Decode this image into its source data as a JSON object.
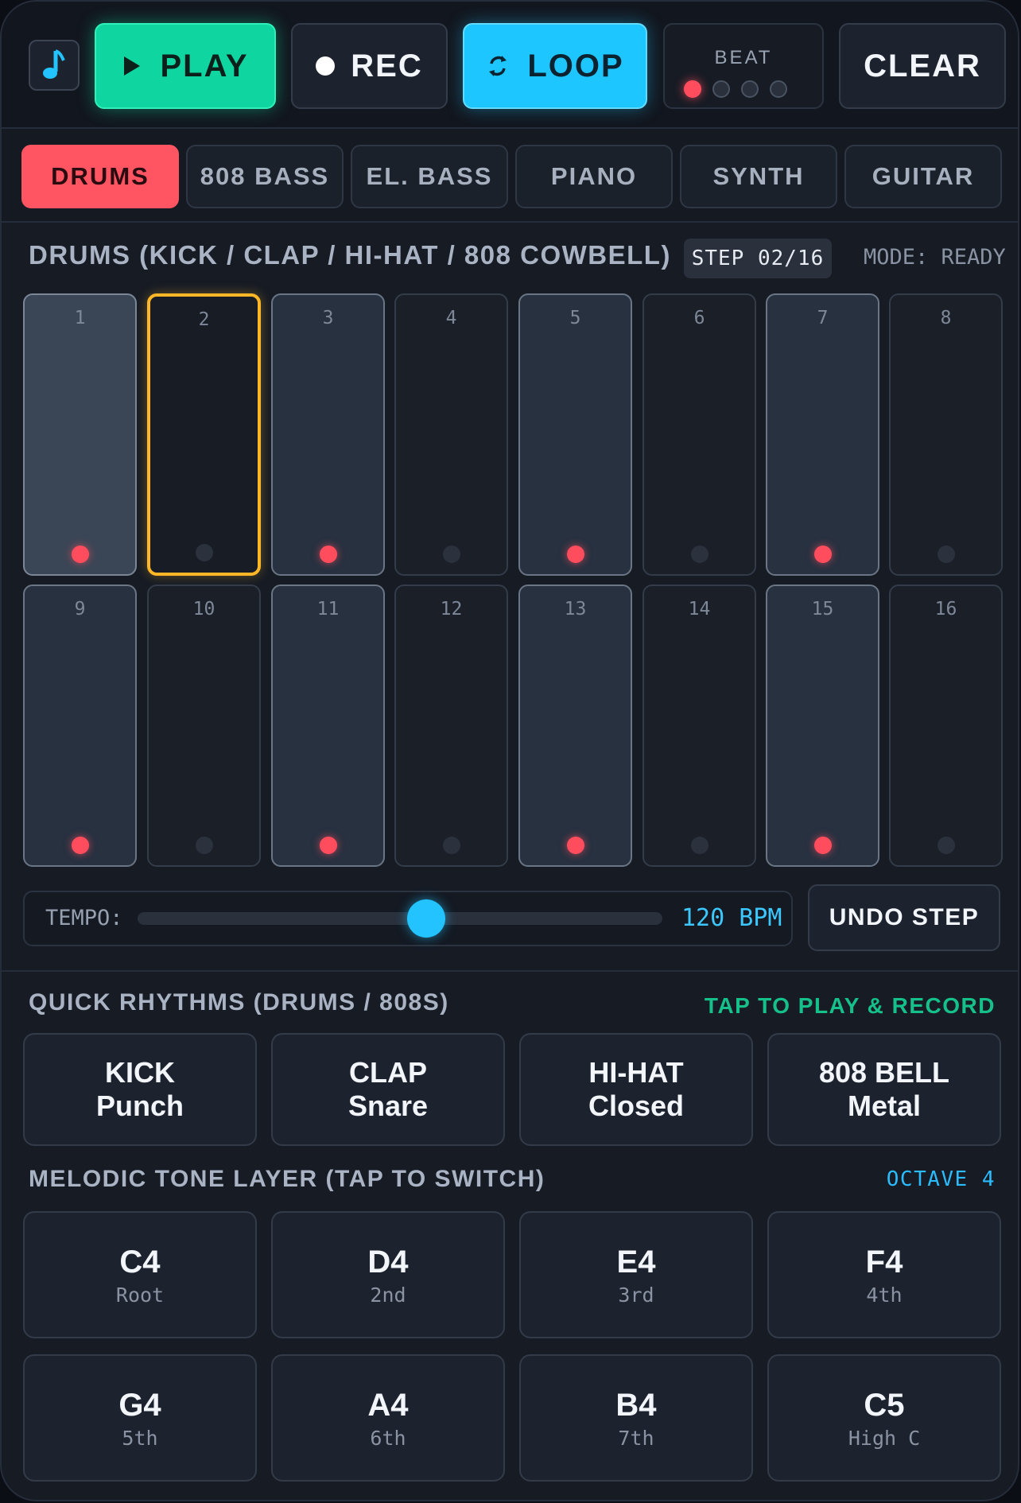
{
  "transport": {
    "play_label": "PLAY",
    "rec_label": "REC",
    "loop_label": "LOOP",
    "beat_label": "BEAT",
    "beat_active_index": 0,
    "clear_label": "CLEAR"
  },
  "instruments": {
    "tabs": [
      "DRUMS",
      "808 BASS",
      "EL. BASS",
      "PIANO",
      "SYNTH",
      "GUITAR"
    ],
    "active": "DRUMS"
  },
  "sequencer": {
    "title": "DRUMS (KICK / CLAP / HI-HAT / 808 COWBELL)",
    "step_badge": "STEP 02/16",
    "mode": "MODE: READY",
    "current_step": 2,
    "steps": [
      {
        "num": "1",
        "on": true
      },
      {
        "num": "2",
        "on": false
      },
      {
        "num": "3",
        "on": true
      },
      {
        "num": "4",
        "on": false
      },
      {
        "num": "5",
        "on": true
      },
      {
        "num": "6",
        "on": false
      },
      {
        "num": "7",
        "on": true
      },
      {
        "num": "8",
        "on": false
      },
      {
        "num": "9",
        "on": true
      },
      {
        "num": "10",
        "on": false
      },
      {
        "num": "11",
        "on": true
      },
      {
        "num": "12",
        "on": false
      },
      {
        "num": "13",
        "on": true
      },
      {
        "num": "14",
        "on": false
      },
      {
        "num": "15",
        "on": true
      },
      {
        "num": "16",
        "on": false
      }
    ]
  },
  "tempo": {
    "label": "TEMPO:",
    "value_text": "120 BPM",
    "slider_fraction": 0.55
  },
  "undo_label": "UNDO STEP",
  "quick_rhythms": {
    "title": "QUICK RHYTHMS (DRUMS / 808S)",
    "hint": "TAP TO PLAY & RECORD",
    "items": [
      {
        "line1": "KICK",
        "line2": "Punch"
      },
      {
        "line1": "CLAP",
        "line2": "Snare"
      },
      {
        "line1": "HI-HAT",
        "line2": "Closed"
      },
      {
        "line1": "808 BELL",
        "line2": "Metal"
      }
    ]
  },
  "melodic": {
    "title": "MELODIC TONE LAYER (TAP TO SWITCH)",
    "octave": "OCTAVE 4",
    "notes": [
      {
        "name": "C4",
        "sub": "Root"
      },
      {
        "name": "D4",
        "sub": "2nd"
      },
      {
        "name": "E4",
        "sub": "3rd"
      },
      {
        "name": "F4",
        "sub": "4th"
      },
      {
        "name": "G4",
        "sub": "5th"
      },
      {
        "name": "A4",
        "sub": "6th"
      },
      {
        "name": "B4",
        "sub": "7th"
      },
      {
        "name": "C5",
        "sub": "High C"
      }
    ]
  },
  "colors": {
    "play": "#0fd6a0",
    "loop": "#1ec6ff",
    "active_tab": "#ff5563",
    "current_step": "#ffb627",
    "hit_dot": "#ff4d5e",
    "hint_green": "#16c08a",
    "octave_blue": "#2bbcff"
  }
}
